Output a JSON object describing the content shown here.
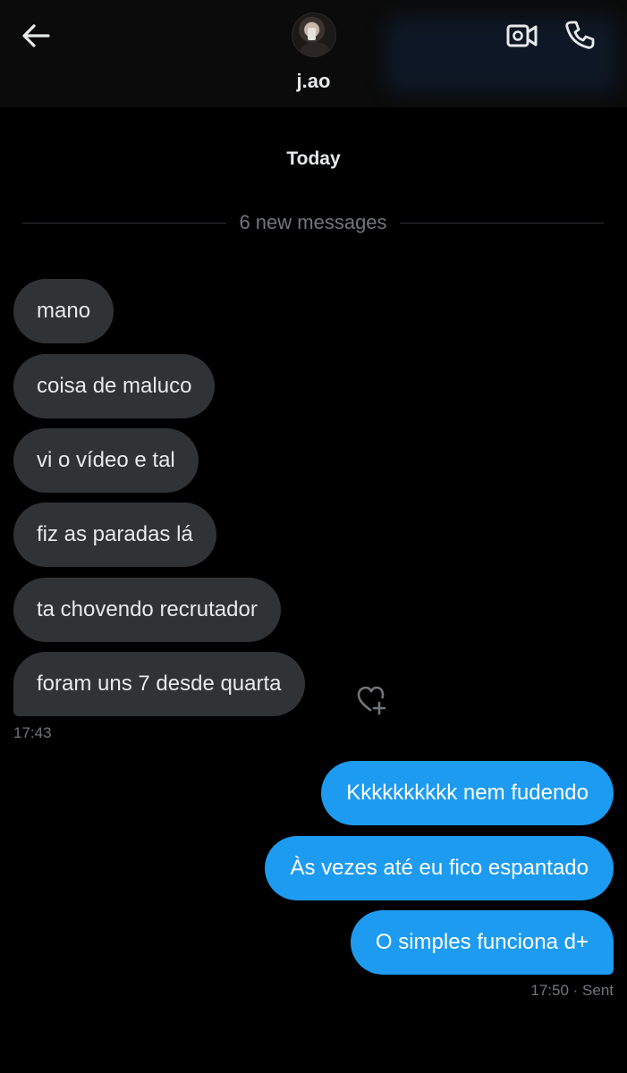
{
  "header": {
    "back_icon": "arrow-left-icon",
    "username": "j.ao",
    "video_icon": "video-camera-icon",
    "call_icon": "phone-icon"
  },
  "conversation": {
    "day_label": "Today",
    "new_messages_label": "6 new messages",
    "incoming": [
      "mano",
      "coisa de maluco",
      "vi o vídeo e tal",
      "fiz as paradas lá",
      "ta chovendo recrutador",
      "foram uns 7 desde quarta"
    ],
    "incoming_time": "17:43",
    "reaction_icon": "heart-plus-icon",
    "outgoing": [
      "Kkkkkkkkkk nem fudendo",
      "Às vezes até eu fico espantado",
      "O simples funciona d+"
    ],
    "outgoing_time": "17:50 · Sent"
  },
  "colors": {
    "background": "#000000",
    "incoming_bubble": "#2f3336",
    "outgoing_bubble": "#1d9bf0",
    "muted_text": "#71767b"
  }
}
